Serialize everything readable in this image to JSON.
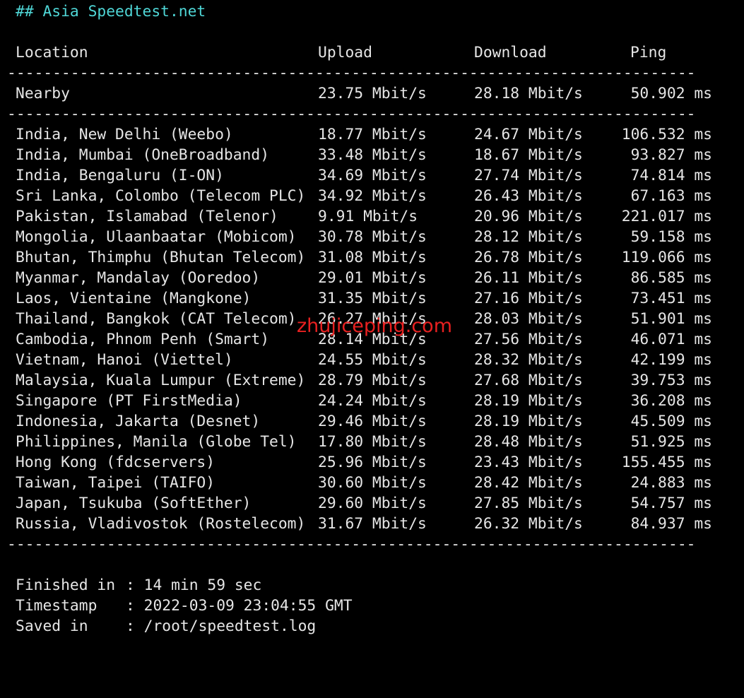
{
  "heading": "## Asia Speedtest.net",
  "columns": {
    "location": "Location",
    "upload": "Upload",
    "download": "Download",
    "ping": "Ping"
  },
  "separator": "----------------------------------------------------------------------------",
  "nearby": {
    "location": "Nearby",
    "upload": "23.75 Mbit/s",
    "download": "28.18 Mbit/s",
    "ping": "50.902 ms"
  },
  "rows": [
    {
      "location": "India, New Delhi (Weebo)",
      "upload": "18.77 Mbit/s",
      "download": "24.67 Mbit/s",
      "ping": "106.532 ms"
    },
    {
      "location": "India, Mumbai (OneBroadband)",
      "upload": "33.48 Mbit/s",
      "download": "18.67 Mbit/s",
      "ping": "93.827 ms"
    },
    {
      "location": "India, Bengaluru (I-ON)",
      "upload": "34.69 Mbit/s",
      "download": "27.74 Mbit/s",
      "ping": "74.814 ms"
    },
    {
      "location": "Sri Lanka, Colombo (Telecom PLC)",
      "upload": "34.92 Mbit/s",
      "download": "26.43 Mbit/s",
      "ping": "67.163 ms"
    },
    {
      "location": "Pakistan, Islamabad (Telenor)",
      "upload": "9.91 Mbit/s",
      "download": "20.96 Mbit/s",
      "ping": "221.017 ms"
    },
    {
      "location": "Mongolia, Ulaanbaatar (Mobicom)",
      "upload": "30.78 Mbit/s",
      "download": "28.12 Mbit/s",
      "ping": "59.158 ms"
    },
    {
      "location": "Bhutan, Thimphu (Bhutan Telecom)",
      "upload": "31.08 Mbit/s",
      "download": "26.78 Mbit/s",
      "ping": "119.066 ms"
    },
    {
      "location": "Myanmar, Mandalay (Ooredoo)",
      "upload": "29.01 Mbit/s",
      "download": "26.11 Mbit/s",
      "ping": "86.585 ms"
    },
    {
      "location": "Laos, Vientaine (Mangkone)",
      "upload": "31.35 Mbit/s",
      "download": "27.16 Mbit/s",
      "ping": "73.451 ms"
    },
    {
      "location": "Thailand, Bangkok (CAT Telecom)",
      "upload": "26.27 Mbit/s",
      "download": "28.03 Mbit/s",
      "ping": "51.901 ms"
    },
    {
      "location": "Cambodia, Phnom Penh (Smart)",
      "upload": "28.14 Mbit/s",
      "download": "27.56 Mbit/s",
      "ping": "46.071 ms"
    },
    {
      "location": "Vietnam, Hanoi (Viettel)",
      "upload": "24.55 Mbit/s",
      "download": "28.32 Mbit/s",
      "ping": "42.199 ms"
    },
    {
      "location": "Malaysia, Kuala Lumpur (Extreme)",
      "upload": "28.79 Mbit/s",
      "download": "27.68 Mbit/s",
      "ping": "39.753 ms"
    },
    {
      "location": "Singapore (PT FirstMedia)",
      "upload": "24.24 Mbit/s",
      "download": "28.19 Mbit/s",
      "ping": "36.208 ms"
    },
    {
      "location": "Indonesia, Jakarta (Desnet)",
      "upload": "29.46 Mbit/s",
      "download": "28.19 Mbit/s",
      "ping": "45.509 ms"
    },
    {
      "location": "Philippines, Manila (Globe Tel)",
      "upload": "17.80 Mbit/s",
      "download": "28.48 Mbit/s",
      "ping": "51.925 ms"
    },
    {
      "location": "Hong Kong (fdcservers)",
      "upload": "25.96 Mbit/s",
      "download": "23.43 Mbit/s",
      "ping": "155.455 ms"
    },
    {
      "location": "Taiwan, Taipei (TAIFO)",
      "upload": "30.60 Mbit/s",
      "download": "28.42 Mbit/s",
      "ping": "24.883 ms"
    },
    {
      "location": "Japan, Tsukuba (SoftEther)",
      "upload": "29.60 Mbit/s",
      "download": "27.85 Mbit/s",
      "ping": "54.757 ms"
    },
    {
      "location": "Russia, Vladivostok (Rostelecom)",
      "upload": "31.67 Mbit/s",
      "download": "26.32 Mbit/s",
      "ping": "84.937 ms"
    }
  ],
  "footer": [
    {
      "key": "Finished in",
      "value": ": 14 min 59 sec"
    },
    {
      "key": "Timestamp",
      "value": ": 2022-03-09 23:04:55 GMT"
    },
    {
      "key": "Saved in",
      "value": ": /root/speedtest.log"
    }
  ],
  "watermark": "zhujiceping.com",
  "colors": {
    "background": "#000000",
    "text": "#e6e6e6",
    "heading": "#4fd6d6",
    "watermark": "#e82020"
  }
}
